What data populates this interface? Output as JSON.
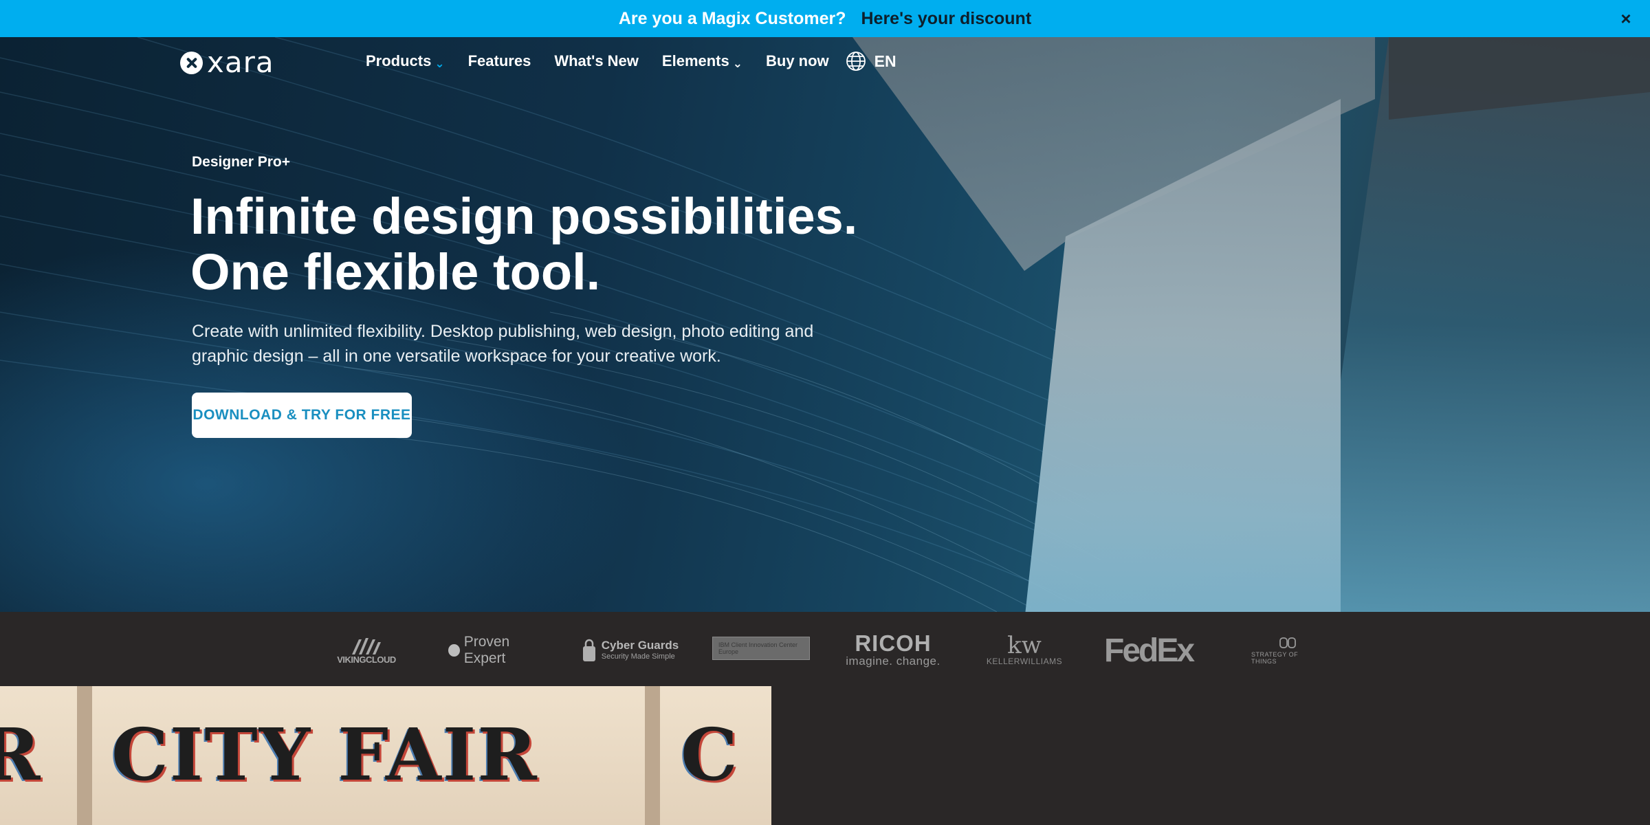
{
  "promo": {
    "question": "Are you a Magix Customer?",
    "link": "Here's your discount",
    "close": "×"
  },
  "nav": {
    "logo_text": "xara",
    "items": [
      {
        "label": "Products",
        "dropdown": true,
        "chevron_color": "#00aeef"
      },
      {
        "label": "Features",
        "dropdown": false
      },
      {
        "label": "What's New",
        "dropdown": false
      },
      {
        "label": "Elements",
        "dropdown": true,
        "chevron_color": "#ffffff"
      },
      {
        "label": "Buy now",
        "dropdown": false
      }
    ],
    "chevron": "⌄",
    "language": "EN"
  },
  "hero": {
    "eyebrow": "Designer Pro+",
    "headline_line1": "Infinite design possibilities.",
    "headline_line2": "One flexible tool.",
    "subtext": "Create with unlimited flexibility. Desktop publishing, web design, photo editing and graphic design – all in one versatile workspace for your creative work.",
    "cta": "DOWNLOAD & TRY FOR FREE"
  },
  "clients": {
    "viking": "VIKINGCLOUD",
    "proven": "Proven Expert",
    "cyber_title": "Cyber Guards",
    "cyber_sub": "Security Made Simple",
    "ibm": "IBM Client Innovation Center Europe",
    "ricoh_title": "RICOH",
    "ricoh_sub": "imagine. change.",
    "kw_title": "kw",
    "kw_sub": "KELLERWILLIAMS",
    "fedex": "FedEx",
    "strategy": "STRATEGY OF THINGS"
  },
  "poster": {
    "left_text": "R",
    "main_text": "CITY FAIR",
    "right_text": "C"
  },
  "colors": {
    "promo_bg": "#00aeef",
    "accent": "#00aeef",
    "page_bg": "#2a2727",
    "cta_text": "#1a8fc0"
  }
}
